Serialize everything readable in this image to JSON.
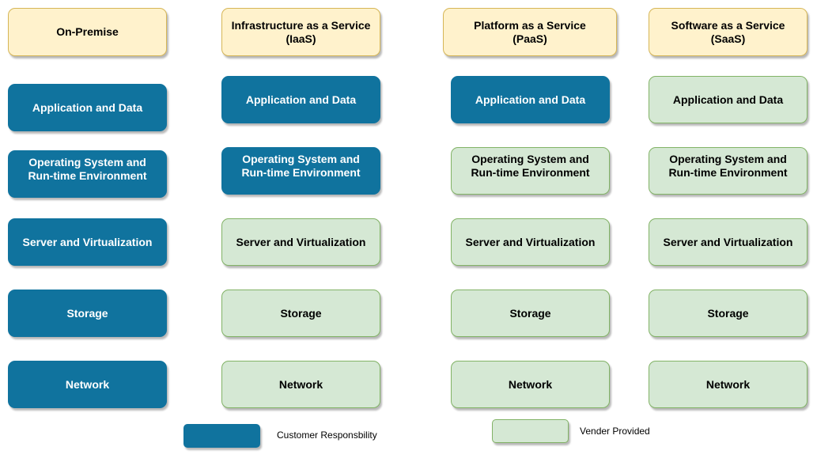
{
  "colors": {
    "header_fill": "#fff2cc",
    "header_stroke": "#d6b656",
    "customer_fill": "#10739e",
    "vendor_fill": "#d5e8d4",
    "vendor_stroke": "#82b366"
  },
  "columns": [
    {
      "header": "On-Premise",
      "layers": [
        {
          "label": "Application and Data",
          "owner": "customer"
        },
        {
          "label": "Operating System and\nRun-time Environment",
          "owner": "customer"
        },
        {
          "label": "Server and Virtualization",
          "owner": "customer"
        },
        {
          "label": "Storage",
          "owner": "customer"
        },
        {
          "label": "Network",
          "owner": "customer"
        }
      ]
    },
    {
      "header": "Infrastructure as a Service\n(IaaS)",
      "layers": [
        {
          "label": "Application and Data",
          "owner": "customer"
        },
        {
          "label": "Operating System and\nRun-time Environment",
          "owner": "customer"
        },
        {
          "label": "Server and Virtualization",
          "owner": "vendor"
        },
        {
          "label": "Storage",
          "owner": "vendor"
        },
        {
          "label": "Network",
          "owner": "vendor"
        }
      ]
    },
    {
      "header": "Platform as a Service\n(PaaS)",
      "layers": [
        {
          "label": "Application and Data",
          "owner": "customer"
        },
        {
          "label": "Operating System and\nRun-time Environment",
          "owner": "vendor"
        },
        {
          "label": "Server and Virtualization",
          "owner": "vendor"
        },
        {
          "label": "Storage",
          "owner": "vendor"
        },
        {
          "label": "Network",
          "owner": "vendor"
        }
      ]
    },
    {
      "header": "Software as a Service\n(SaaS)",
      "layers": [
        {
          "label": "Application and Data",
          "owner": "vendor"
        },
        {
          "label": "Operating System and\nRun-time Environment",
          "owner": "vendor"
        },
        {
          "label": "Server and Virtualization",
          "owner": "vendor"
        },
        {
          "label": "Storage",
          "owner": "vendor"
        },
        {
          "label": "Network",
          "owner": "vendor"
        }
      ]
    }
  ],
  "legend": {
    "customer": "Customer Responsbility",
    "vendor": "Vender Provided"
  }
}
